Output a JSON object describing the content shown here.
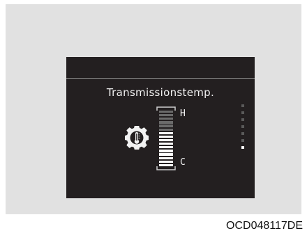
{
  "display": {
    "title": "Transmissionstemp.",
    "high_label": "H",
    "low_label": "C",
    "icon": "gear-thermometer-icon",
    "gauge": {
      "total_segments": 16,
      "filled_segments": 10,
      "fill_color": "#ffffff",
      "empty_color": "#6b6b6b"
    },
    "page_indicator": {
      "count": 7,
      "active_index": 6
    }
  },
  "caption": "OCD048117DE",
  "colors": {
    "screen_background": "#231f20",
    "panel_background": "#e1e1e1",
    "text": "#f2f2f2"
  }
}
